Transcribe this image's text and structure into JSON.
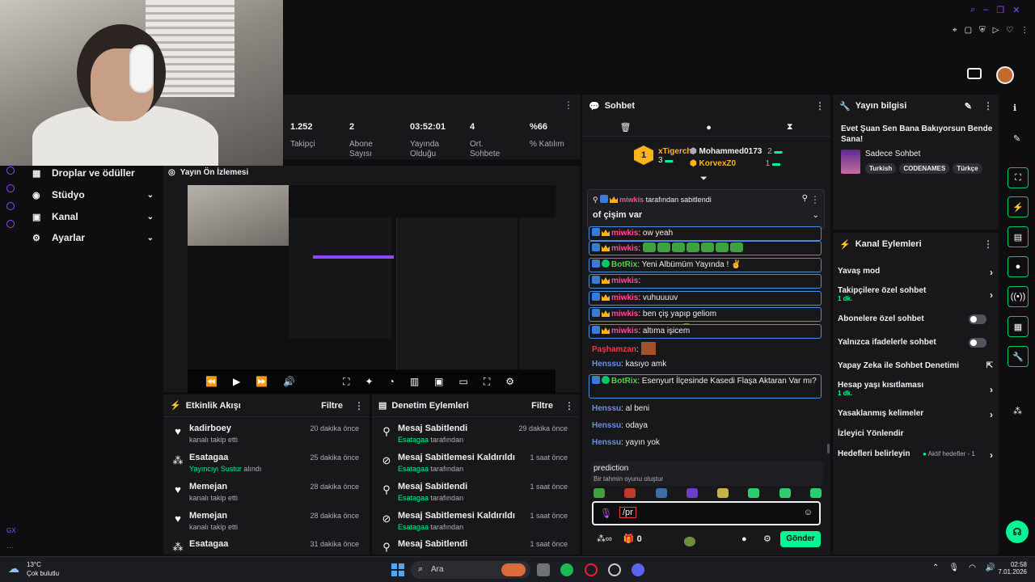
{
  "stats": [
    {
      "value": "1.252",
      "label": "Takipçi"
    },
    {
      "value": "2",
      "label": "Abone Sayısı"
    },
    {
      "value": "03:52:01",
      "label": "Yayında Olduğu"
    },
    {
      "value": "4",
      "label": "Ort. Sohbete"
    },
    {
      "value": "%66",
      "label": "% Katılım"
    }
  ],
  "nav": {
    "items": [
      {
        "label": "Droplar ve ödüller"
      },
      {
        "label": "Stüdyo"
      },
      {
        "label": "Kanal"
      },
      {
        "label": "Ayarlar"
      }
    ],
    "tiny_label": "GX"
  },
  "preview": {
    "title": "Yayın Ön İzlemesi"
  },
  "activity": {
    "title": "Etkinlik Akışı",
    "filter": "Filtre",
    "items": [
      {
        "name": "kadirboey",
        "sub": "kanalı takip etti",
        "time": "20 dakika önce",
        "icon": "heart-icon"
      },
      {
        "name": "Esatagaa",
        "sub_green": "Yayıncıyı Sustur",
        "sub": "alındı",
        "time": "25 dakika önce",
        "icon": "bits-icon"
      },
      {
        "name": "Memejan",
        "sub": "kanalı takip etti",
        "time": "28 dakika önce",
        "icon": "heart-icon"
      },
      {
        "name": "Memejan",
        "sub": "kanalı takip etti",
        "time": "28 dakika önce",
        "icon": "heart-icon"
      },
      {
        "name": "Esatagaa",
        "sub": "",
        "time": "31 dakika önce",
        "icon": "bits-icon"
      }
    ]
  },
  "moderation": {
    "title": "Denetim Eylemleri",
    "filter": "Filtre",
    "items": [
      {
        "name": "Mesaj Sabitlendi",
        "sub_green": "Esatagaa",
        "sub": "tarafından",
        "time": "29 dakika önce"
      },
      {
        "name": "Mesaj Sabitlemesi Kaldırıldı",
        "sub_green": "Esatagaa",
        "sub": "tarafından",
        "time": "1 saat önce"
      },
      {
        "name": "Mesaj Sabitlendi",
        "sub_green": "Esatagaa",
        "sub": "tarafından",
        "time": "1 saat önce"
      },
      {
        "name": "Mesaj Sabitlemesi Kaldırıldı",
        "sub_green": "Esatagaa",
        "sub": "tarafından",
        "time": "1 saat önce"
      },
      {
        "name": "Mesaj Sabitlendi",
        "sub_green": "",
        "sub": "",
        "time": "1 saat önce"
      }
    ]
  },
  "chat": {
    "title": "Sohbet",
    "leaderboard": [
      {
        "rank": "1",
        "name": "xTigerch",
        "count": "3"
      },
      {
        "name": "Mohammed0173",
        "count": "2"
      },
      {
        "name": "KorvexZ0",
        "count": "1"
      }
    ],
    "pinned": {
      "by_user": "miwkis",
      "by_text": "tarafından sabitlendi",
      "text": "of çişim var"
    },
    "messages": [
      {
        "user": "miwkis",
        "text": ": ow yeah",
        "color": "pink",
        "hl": true
      },
      {
        "user": "miwkis",
        "text": ":",
        "color": "pink",
        "hl": true,
        "emotes": 7
      },
      {
        "user": "BotRix",
        "text": ": Yeni Albümüm Yayında ! ✌",
        "color": "green",
        "hl": true
      },
      {
        "user": "miwkis",
        "text": ":",
        "color": "pink",
        "hl": true,
        "emotes_face": 6
      },
      {
        "user": "miwkis",
        "text": ": vuhuuuuv",
        "color": "pink",
        "hl": true
      },
      {
        "user": "miwkis",
        "text": ": ben çiş yapıp geliom",
        "color": "pink",
        "hl": true
      },
      {
        "user": "miwkis",
        "text": ": altıma işicem",
        "color": "pink",
        "hl": true
      },
      {
        "user": "Paşhamzan",
        "text": ":",
        "color": "red",
        "hl": false
      },
      {
        "user": "Henssu",
        "text": ": kasıyo amk",
        "color": "blue",
        "hl": false
      },
      {
        "user": "BotRix",
        "text": ": Esenyurt İlçesinde Kasedi Flaşa Aktaran Var mı?",
        "color": "green",
        "hl": true
      },
      {
        "user": "Henssu",
        "text": ": al beni",
        "color": "blue",
        "hl": false
      },
      {
        "user": "Henssu",
        "text": ": odaya",
        "color": "blue",
        "hl": false
      },
      {
        "user": "Henssu",
        "text": ": yayın yok",
        "color": "blue",
        "hl": false
      }
    ],
    "suggestion": {
      "title": "prediction",
      "sub": "Bir tahmin oyunu oluştur"
    },
    "input_value": "/pr",
    "points": "0",
    "send_label": "Gönder"
  },
  "stream_info": {
    "title": "Yayın bilgisi",
    "stream_title": "Evet Şuan Sen Bana Bakıyorsun Bende Sana!",
    "category": "Sadece Sohbet",
    "tags": [
      "Turkish",
      "CODENAMES",
      "Türkçe"
    ]
  },
  "channel_actions": {
    "title": "Kanal Eylemleri",
    "items": [
      {
        "label": "Yavaş mod"
      },
      {
        "label": "Takipçilere özel sohbet",
        "sub": "1 dk."
      },
      {
        "label": "Abonelere özel sohbet"
      },
      {
        "label": "Yalnızca ifadelerle sohbet"
      },
      {
        "label": "Yapay Zeka ile Sohbet Denetimi"
      },
      {
        "label": "Hesap yaşı kısıtlaması",
        "sub": "1 dk."
      },
      {
        "label": "Yasaklanmış kelimeler"
      },
      {
        "label": "İzleyici Yönlendir"
      },
      {
        "label": "Hedefleri belirleyin",
        "extra": "Aktif hedefler - 1"
      }
    ]
  },
  "taskbar": {
    "weather_temp": "13°C",
    "weather_desc": "Çok bulutlu",
    "search_placeholder": "Ara",
    "time": "02:58",
    "date": "7.01.2026"
  },
  "colors": {
    "accent": "#00f593",
    "panel": "#18181b",
    "bg": "#0e0e10",
    "highlight_border": "#4c8dde"
  }
}
